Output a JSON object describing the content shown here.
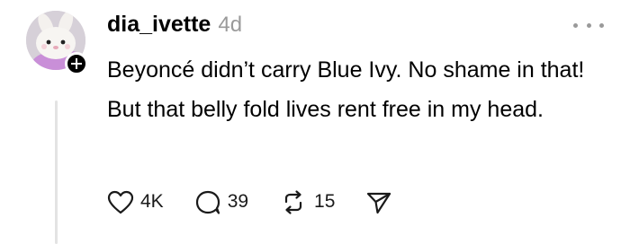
{
  "post": {
    "username": "dia_ivette",
    "time": "4d",
    "text": "Beyoncé didn’t carry Blue Ivy. No shame in that! But that belly fold lives rent free in my head."
  },
  "avatar": {
    "icon": "plush-bunny-avatar",
    "follow_icon": "plus-icon"
  },
  "actions": {
    "likes": "4K",
    "replies": "39",
    "reposts": "15"
  },
  "icons": {
    "more": "more-dots-icon",
    "like": "heart-icon",
    "reply": "comment-icon",
    "repost": "repost-icon",
    "share": "send-icon"
  },
  "colors": {
    "text": "#000000",
    "muted": "#9a9a9a",
    "thread_line": "#e3e3e3"
  }
}
